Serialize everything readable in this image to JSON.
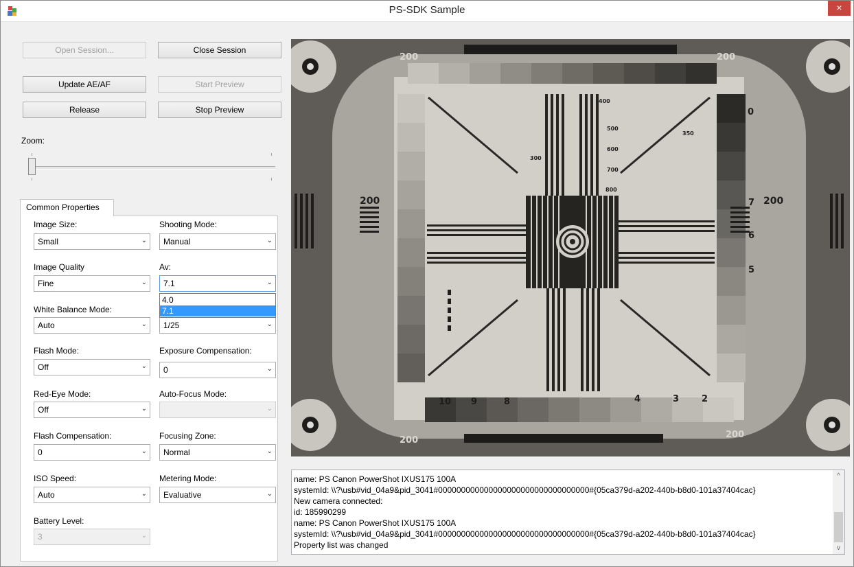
{
  "window": {
    "title": "PS-SDK Sample",
    "close_glyph": "×"
  },
  "buttons": {
    "open_session": "Open Session...",
    "close_session": "Close Session",
    "update_ae_af": "Update AE/AF",
    "start_preview": "Start Preview",
    "release": "Release",
    "stop_preview": "Stop Preview"
  },
  "zoom": {
    "label": "Zoom:",
    "value": 0
  },
  "tab": {
    "label": "Common Properties"
  },
  "props": {
    "image_size": {
      "label": "Image Size:",
      "value": "Small"
    },
    "shooting_mode": {
      "label": "Shooting Mode:",
      "value": "Manual"
    },
    "image_quality": {
      "label": "Image Quality",
      "value": "Fine"
    },
    "av": {
      "label": "Av:",
      "value": "7.1",
      "options": [
        "4.0",
        "7.1"
      ]
    },
    "white_balance": {
      "label": "White Balance Mode:",
      "value": "Auto"
    },
    "tv": {
      "value": "1/25"
    },
    "flash_mode": {
      "label": "Flash Mode:",
      "value": "Off"
    },
    "exposure_comp": {
      "label": "Exposure Compensation:",
      "value": "0"
    },
    "red_eye": {
      "label": "Red-Eye Mode:",
      "value": "Off"
    },
    "auto_focus": {
      "label": "Auto-Focus Mode:",
      "value": ""
    },
    "flash_comp": {
      "label": "Flash Compensation:",
      "value": "0"
    },
    "focusing_zone": {
      "label": "Focusing Zone:",
      "value": "Normal"
    },
    "iso": {
      "label": "ISO Speed:",
      "value": "Auto"
    },
    "metering": {
      "label": "Metering Mode:",
      "value": "Evaluative"
    },
    "battery": {
      "label": "Battery Level:",
      "value": "3"
    }
  },
  "preview": {
    "numbers": [
      "200",
      "200",
      "200",
      "200",
      "200",
      "200",
      "400",
      "500",
      "600",
      "700",
      "800",
      "300",
      "350",
      "10",
      "9",
      "8",
      "4",
      "3",
      "2",
      "0",
      "7",
      "6",
      "5"
    ]
  },
  "log": {
    "lines": [
      "   name: PS Canon PowerShot IXUS175 100A",
      "   systemId: \\\\?\\usb#vid_04a9&pid_3041#000000000000000000000000000000000#{05ca379d-a202-440b-b8d0-101a37404cac}",
      "New camera connected:",
      "   id: 185990299",
      "   name: PS Canon PowerShot IXUS175 100A",
      "   systemId: \\\\?\\usb#vid_04a9&pid_3041#000000000000000000000000000000000#{05ca379d-a202-440b-b8d0-101a37404cac}",
      "Property list was changed"
    ]
  },
  "icons": {
    "dropdown_arrow": "⌄",
    "scroll_up": "^",
    "scroll_down": "v"
  }
}
